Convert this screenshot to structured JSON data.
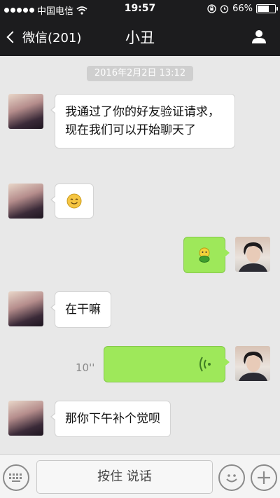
{
  "status_bar": {
    "carrier": "中国电信",
    "time": "19:57",
    "battery_text": "66%",
    "battery_level": 0.66,
    "icons": [
      "signal-dots-icon",
      "wifi-icon",
      "rotation-lock-icon",
      "alarm-icon",
      "battery-icon"
    ]
  },
  "nav": {
    "back_label": "微信(201)",
    "title": "小丑",
    "right_icon": "person-icon"
  },
  "chat": {
    "timestamp": "2016年2月2日 13:12",
    "messages": [
      {
        "from": "other",
        "text": "我通过了你的好友验证请求，现在我们可以开始聊天了"
      },
      {
        "from": "other",
        "type": "emoji",
        "icon": "smile-emoji-icon"
      },
      {
        "from": "me",
        "type": "emoji",
        "icon": "green-smile-sticker-icon"
      },
      {
        "from": "other",
        "text": "在干嘛"
      },
      {
        "from": "me",
        "type": "voice",
        "duration": "10''"
      },
      {
        "from": "other",
        "text": "那你下午补个觉呗"
      }
    ]
  },
  "input_bar": {
    "hold_to_talk": "按住 说话",
    "icons": [
      "keyboard-icon",
      "emoji-icon",
      "plus-icon"
    ]
  },
  "colors": {
    "bar_bg": "#1c1c1e",
    "chat_bg": "#e8e8e8",
    "my_bubble": "#9ee85a",
    "other_bubble": "#ffffff"
  }
}
